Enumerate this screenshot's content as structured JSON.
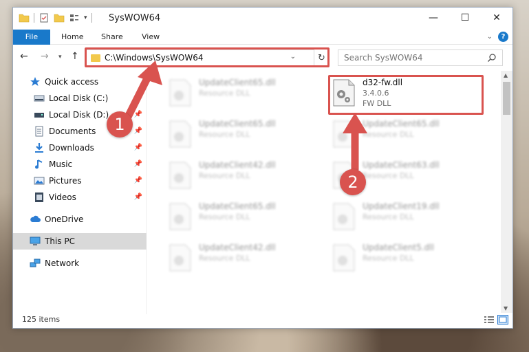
{
  "window": {
    "title": "SysWOW64"
  },
  "ribbon": {
    "tabs": [
      "File",
      "Home",
      "Share",
      "View"
    ]
  },
  "address": {
    "path": "C:\\Windows\\SysWOW64"
  },
  "search": {
    "placeholder": "Search SysWOW64"
  },
  "sidebar": {
    "items": [
      {
        "label": "Quick access",
        "icon": "star-icon",
        "pinned": false
      },
      {
        "label": "Local Disk (C:)",
        "icon": "drive-icon",
        "pinned": true
      },
      {
        "label": "Local Disk (D:)",
        "icon": "drive-icon",
        "pinned": true
      },
      {
        "label": "Documents",
        "icon": "documents-icon",
        "pinned": true
      },
      {
        "label": "Downloads",
        "icon": "download-icon",
        "pinned": true
      },
      {
        "label": "Music",
        "icon": "music-icon",
        "pinned": true
      },
      {
        "label": "Pictures",
        "icon": "pictures-icon",
        "pinned": true
      },
      {
        "label": "Videos",
        "icon": "videos-icon",
        "pinned": true
      },
      {
        "label": "OneDrive",
        "icon": "cloud-icon",
        "pinned": false
      },
      {
        "label": "This PC",
        "icon": "computer-icon",
        "pinned": false,
        "selected": true
      },
      {
        "label": "Network",
        "icon": "network-icon",
        "pinned": false
      }
    ]
  },
  "files": {
    "left": [
      {
        "name": "UpdateClient65.dll",
        "type": "Resource DLL"
      },
      {
        "name": "UpdateClient65.dll",
        "type": "Resource DLL"
      },
      {
        "name": "UpdateClient42.dll",
        "type": "Resource DLL"
      },
      {
        "name": "UpdateClient65.dll",
        "type": "Resource DLL"
      },
      {
        "name": "UpdateClient42.dll",
        "type": "Resource DLL"
      }
    ],
    "highlighted": {
      "name": "d32-fw.dll",
      "version": "3.4.0.6",
      "type": "FW DLL"
    },
    "right": [
      {
        "name": "UpdateClient65.dll",
        "type": "Resource DLL"
      },
      {
        "name": "UpdateClient63.dll",
        "type": "Resource DLL"
      },
      {
        "name": "UpdateClient19.dll",
        "type": "Resource DLL"
      },
      {
        "name": "UpdateClient5.dll",
        "type": "Resource DLL"
      }
    ]
  },
  "status": {
    "item_count": "125 items"
  },
  "annotations": {
    "step1": "1",
    "step2": "2",
    "color": "#d9534f"
  },
  "colors": {
    "accent": "#1979ca",
    "folder": "#f2c94c"
  }
}
